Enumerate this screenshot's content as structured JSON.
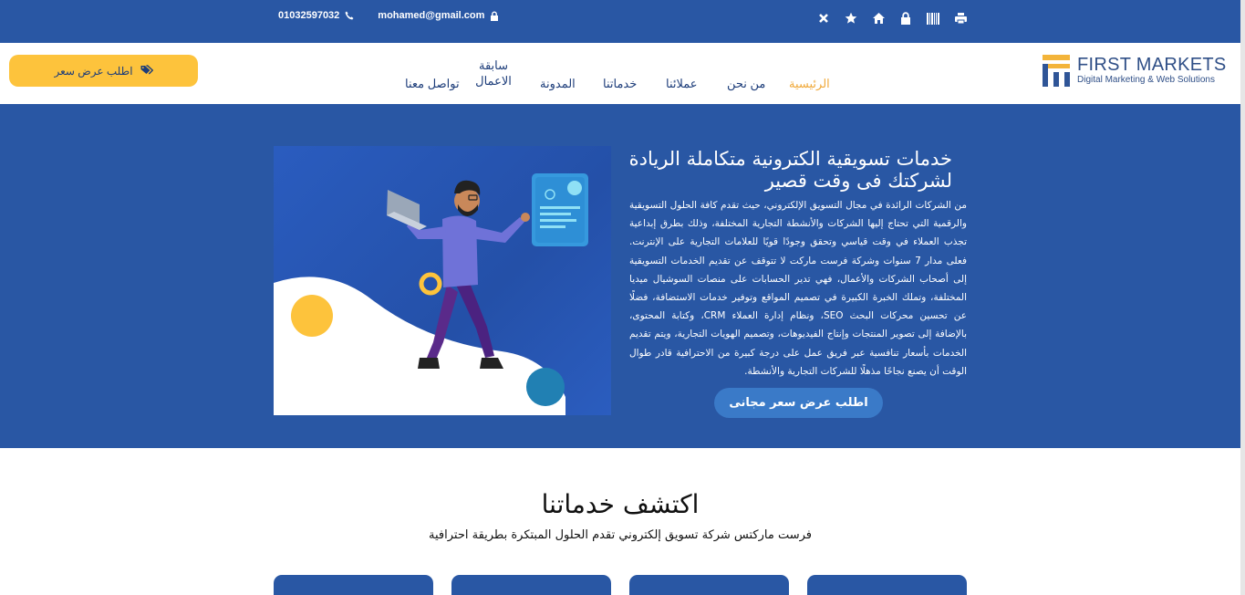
{
  "topbar": {
    "phone": "01032597032",
    "email": "mohamed@gmail.com",
    "icons": [
      "close-icon",
      "star-icon",
      "home-icon",
      "lock-icon",
      "barcode-icon",
      "print-icon"
    ]
  },
  "header": {
    "quote_button": "اطلب عرض سعر",
    "nav": {
      "home": "الرئيسية",
      "about": "من نحن",
      "clients": "عملائنا",
      "services": "خدماتنا",
      "blog": "المدونة",
      "previous_line1": "سابقة",
      "previous_line2": "الاعمال",
      "contact": "تواصل معنا"
    },
    "logo": {
      "title": "FIRST MARKETS",
      "tagline": "Digital Marketing & Web Solutions"
    }
  },
  "hero": {
    "title": "خدمات تسويقية الكترونية متكاملة الريادة لشركتك فى وقت قصير",
    "body": "من الشركات الرائدة في مجال التسويق الإلكتروني، حيث تقدم كافة الحلول التسويقية والرقمية التي تحتاج إليها الشركات والأنشطة التجارية المختلفة، وذلك بطرق إبداعية تجذب العملاء في وقت قياسي وتحقق وجودًا قويًا للعلامات التجارية على الإنترنت. فعلى مدار 7 سنوات وشركة فرست ماركت لا تتوقف عن تقديم الخدمات التسويقية إلى أصحاب الشركات والأعمال، فهي تدير الحسابات على منصات السوشيال ميديا المختلفة، وتملك الخبرة الكبيرة في تصميم المواقع وتوفير خدمات الاستضافة، فضلًا عن تحسين محركات البحث SEO، ونظام إدارة العملاء CRM، وكتابة المحتوى، بالإضافة إلى تصوير المنتجات وإنتاج الفيديوهات، وتصميم الهويات التجارية، ويتم تقديم الخدمات بأسعار تنافسية عبر فريق عمل على درجة كبيرة من الاحترافية قادر طوال الوقت أن يصنع نجاحًا مذهلًا للشركات التجارية والأنشطة.",
    "cta": "اطلب عرض سعر مجانى"
  },
  "services": {
    "title": "اكتشف خدماتنا",
    "subtitle": "فرست ماركتس شركة تسويق إلكتروني تقدم الحلول المبتكرة بطريقة احترافية"
  },
  "colors": {
    "primary": "#2957a4",
    "accent": "#fdc33c",
    "nav_active": "#f0a93a",
    "cta": "#3a7ac8"
  }
}
